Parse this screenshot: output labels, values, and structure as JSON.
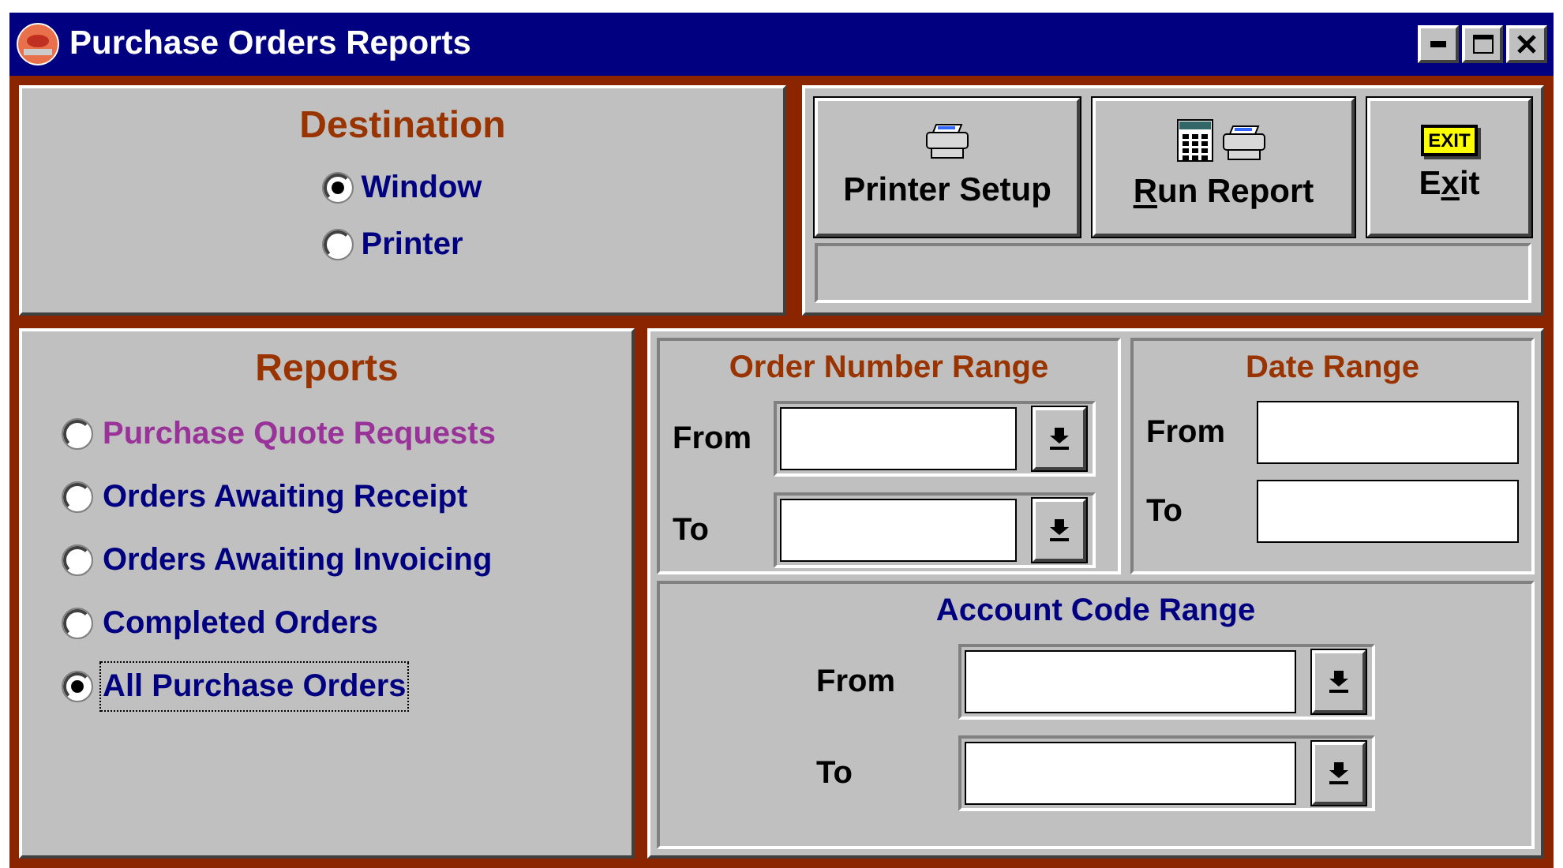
{
  "window": {
    "title": "Purchase Orders Reports"
  },
  "destination": {
    "title": "Destination",
    "options": [
      {
        "label": "Window",
        "selected": true
      },
      {
        "label": "Printer",
        "selected": false
      }
    ]
  },
  "buttons": [
    {
      "kind": "printer",
      "label_before": "Printer Setup"
    },
    {
      "kind": "run",
      "access_key": "R",
      "label_after": "un Report"
    },
    {
      "kind": "exit",
      "icon_text": "EXIT",
      "label_before": "E",
      "access_key": "x",
      "label_after": "it"
    }
  ],
  "reports": {
    "title": "Reports",
    "options": [
      {
        "label": "Purchase Quote Requests",
        "selected": false,
        "color": "#993399"
      },
      {
        "label": "Orders Awaiting Receipt",
        "selected": false,
        "color": "#000080"
      },
      {
        "label": "Orders Awaiting Invoicing",
        "selected": false,
        "color": "#000080"
      },
      {
        "label": "Completed Orders",
        "selected": false,
        "color": "#000080"
      },
      {
        "label": "All Purchase Orders",
        "selected": true,
        "color": "#000080"
      }
    ]
  },
  "order_number_range": {
    "title": "Order Number Range",
    "fields": [
      {
        "label": "From",
        "kind": "combo"
      },
      {
        "label": "To",
        "kind": "combo"
      }
    ]
  },
  "date_range": {
    "title": "Date Range",
    "fields": [
      {
        "label": "From",
        "kind": "text"
      },
      {
        "label": "To",
        "kind": "text"
      }
    ]
  },
  "account_code_range": {
    "title": "Account Code Range",
    "fields": [
      {
        "label": "From",
        "kind": "combo"
      },
      {
        "label": "To",
        "kind": "combo"
      }
    ]
  }
}
